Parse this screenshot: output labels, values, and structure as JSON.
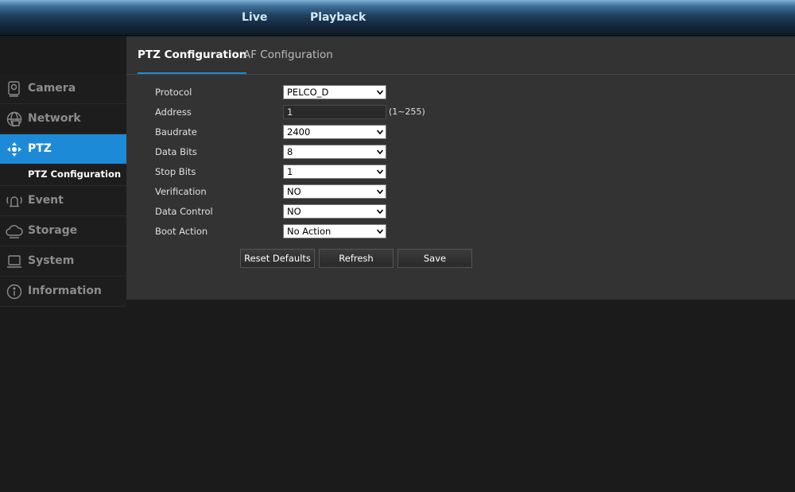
{
  "topnav": {
    "live": "Live",
    "playback": "Playback"
  },
  "sidebar": {
    "items": [
      {
        "label": "Camera",
        "icon": "camera-icon"
      },
      {
        "label": "Network",
        "icon": "network-icon"
      },
      {
        "label": "PTZ",
        "icon": "ptz-icon",
        "active": true
      },
      {
        "label": "Event",
        "icon": "event-icon"
      },
      {
        "label": "Storage",
        "icon": "storage-icon"
      },
      {
        "label": "System",
        "icon": "system-icon"
      },
      {
        "label": "Information",
        "icon": "information-icon"
      }
    ],
    "sub_item": "PTZ Configuration"
  },
  "tabs": [
    {
      "label": "PTZ Configuration",
      "active": true
    },
    {
      "label": "AF Configuration"
    }
  ],
  "form": {
    "protocol": {
      "label": "Protocol",
      "value": "PELCO_D"
    },
    "address": {
      "label": "Address",
      "value": "1",
      "hint": "(1~255)"
    },
    "baudrate": {
      "label": "Baudrate",
      "value": "2400"
    },
    "data_bits": {
      "label": "Data Bits",
      "value": "8"
    },
    "stop_bits": {
      "label": "Stop Bits",
      "value": "1"
    },
    "verification": {
      "label": "Verification",
      "value": "NO"
    },
    "data_control": {
      "label": "Data Control",
      "value": "NO"
    },
    "boot_action": {
      "label": "Boot Action",
      "value": "No Action"
    }
  },
  "buttons": {
    "reset": "Reset Defaults",
    "refresh": "Refresh",
    "save": "Save"
  },
  "colors": {
    "accent": "#1d8ad7",
    "panel": "#333333",
    "background": "#1b1b1b"
  }
}
